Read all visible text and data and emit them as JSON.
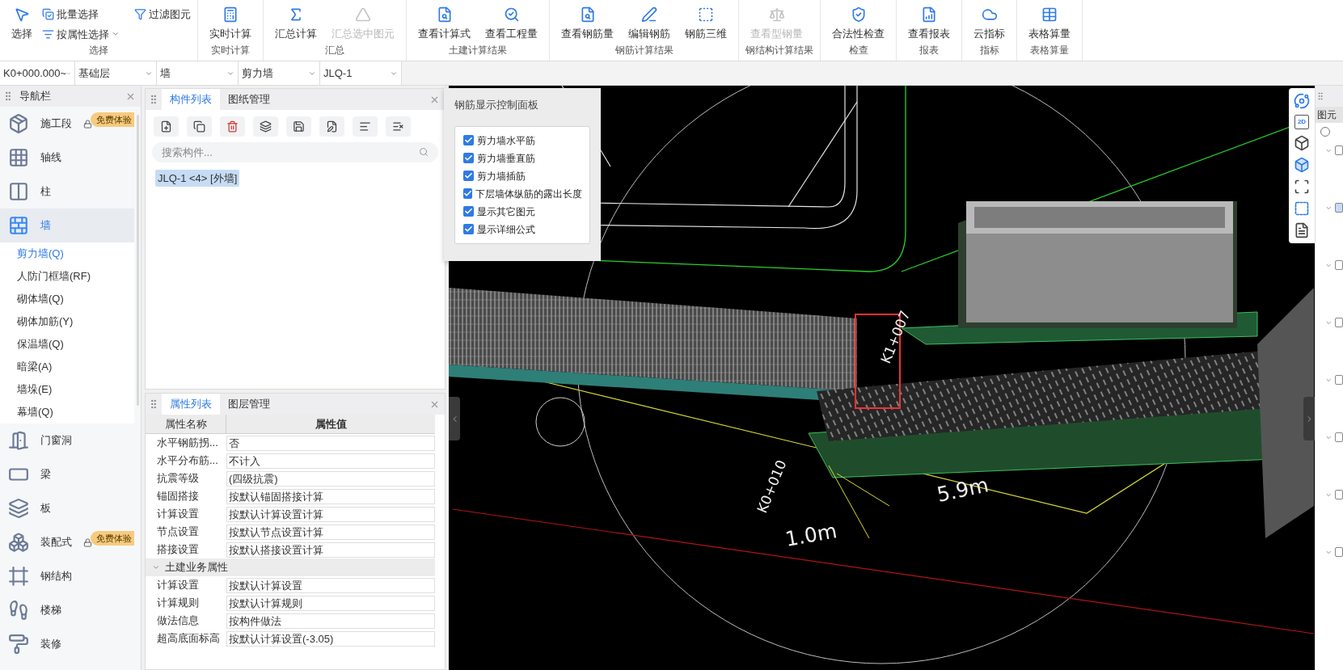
{
  "ribbon": {
    "groups": [
      {
        "label": "选择",
        "items": [
          {
            "label": "选择",
            "kind": "large",
            "disabled": false
          },
          {
            "label": "批量选择",
            "kind": "small",
            "disabled": false
          },
          {
            "label": "按属性选择",
            "kind": "small",
            "disabled": false,
            "has_menu": true
          },
          {
            "label": "过滤图元",
            "kind": "small",
            "disabled": false
          }
        ]
      },
      {
        "label": "实时计算",
        "items": [
          {
            "label": "实时计算",
            "kind": "large",
            "disabled": false
          }
        ]
      },
      {
        "label": "汇总",
        "items": [
          {
            "label": "汇总计算",
            "kind": "large",
            "disabled": false
          },
          {
            "label": "汇总选中图元",
            "kind": "large",
            "disabled": true
          }
        ]
      },
      {
        "label": "土建计算结果",
        "items": [
          {
            "label": "查看计算式",
            "kind": "large",
            "disabled": false
          },
          {
            "label": "查看工程量",
            "kind": "large",
            "disabled": false
          }
        ]
      },
      {
        "label": "钢筋计算结果",
        "items": [
          {
            "label": "查看钢筋量",
            "kind": "large",
            "disabled": false
          },
          {
            "label": "编辑钢筋",
            "kind": "large",
            "disabled": false
          },
          {
            "label": "钢筋三维",
            "kind": "large",
            "disabled": false
          }
        ]
      },
      {
        "label": "钢结构计算结果",
        "items": [
          {
            "label": "查看型钢量",
            "kind": "large",
            "disabled": true
          }
        ]
      },
      {
        "label": "检查",
        "items": [
          {
            "label": "合法性检查",
            "kind": "large",
            "disabled": false
          }
        ]
      },
      {
        "label": "报表",
        "items": [
          {
            "label": "查看报表",
            "kind": "large",
            "disabled": false
          }
        ]
      },
      {
        "label": "指标",
        "items": [
          {
            "label": "云指标",
            "kind": "large",
            "disabled": false
          }
        ]
      },
      {
        "label": "表格算量",
        "items": [
          {
            "label": "表格算量",
            "kind": "large",
            "disabled": false
          }
        ]
      }
    ]
  },
  "filters": [
    {
      "value": "K0+000.000~"
    },
    {
      "value": "基础层"
    },
    {
      "value": "墙"
    },
    {
      "value": "剪力墙"
    },
    {
      "value": "JLQ-1"
    }
  ],
  "navigation": {
    "title": "导航栏",
    "items": [
      {
        "label": "施工段",
        "selected": false,
        "locked": true,
        "badge": "免费体验"
      },
      {
        "label": "轴线",
        "selected": false
      },
      {
        "label": "柱",
        "selected": false
      },
      {
        "label": "墙",
        "selected": true,
        "children": [
          {
            "label": "剪力墙(Q)",
            "selected": true
          },
          {
            "label": "人防门框墙(RF)",
            "selected": false
          },
          {
            "label": "砌体墙(Q)",
            "selected": false
          },
          {
            "label": "砌体加筋(Y)",
            "selected": false
          },
          {
            "label": "保温墙(Q)",
            "selected": false
          },
          {
            "label": "暗梁(A)",
            "selected": false
          },
          {
            "label": "墙垛(E)",
            "selected": false
          },
          {
            "label": "幕墙(Q)",
            "selected": false
          }
        ]
      },
      {
        "label": "门窗洞",
        "selected": false
      },
      {
        "label": "梁",
        "selected": false
      },
      {
        "label": "板",
        "selected": false
      },
      {
        "label": "装配式",
        "selected": false,
        "locked": true,
        "badge": "免费体验"
      },
      {
        "label": "钢结构",
        "selected": false
      },
      {
        "label": "楼梯",
        "selected": false
      },
      {
        "label": "装修",
        "selected": false
      }
    ]
  },
  "component_panel": {
    "tabs": [
      {
        "label": "构件列表",
        "selected": true
      },
      {
        "label": "图纸管理",
        "selected": false
      }
    ],
    "search": {
      "placeholder": "搜索构件..."
    },
    "items": [
      {
        "label": "JLQ-1 <4> [外墙]",
        "selected": true
      }
    ]
  },
  "property_panel": {
    "tabs": [
      {
        "label": "属性列表",
        "selected": true
      },
      {
        "label": "图层管理",
        "selected": false
      }
    ],
    "columns": [
      "属性名称",
      "属性值"
    ],
    "rows": [
      {
        "kind": "row",
        "name": "水平钢筋拐...",
        "value": "否"
      },
      {
        "kind": "row",
        "name": "水平分布筋...",
        "value": "不计入"
      },
      {
        "kind": "row",
        "name": "抗震等级",
        "value": "(四级抗震)"
      },
      {
        "kind": "row",
        "name": "锚固搭接",
        "value": "按默认锚固搭接计算"
      },
      {
        "kind": "row",
        "name": "计算设置",
        "value": "按默认计算设置计算"
      },
      {
        "kind": "row",
        "name": "节点设置",
        "value": "按默认节点设置计算"
      },
      {
        "kind": "row",
        "name": "搭接设置",
        "value": "按默认搭接设置计算"
      },
      {
        "kind": "group",
        "name": "土建业务属性",
        "expanded": true
      },
      {
        "kind": "row",
        "name": "计算设置",
        "value": "按默认计算设置"
      },
      {
        "kind": "row",
        "name": "计算规则",
        "value": "按默认计算规则"
      },
      {
        "kind": "row",
        "name": "做法信息",
        "value": "按构件做法"
      },
      {
        "kind": "row",
        "name": "超高底面标高",
        "value": "按默认计算设置(-3.05)"
      }
    ]
  },
  "rebar_display_panel": {
    "title": "钢筋显示控制面板",
    "options": [
      {
        "label": "剪力墙水平筋",
        "checked": true
      },
      {
        "label": "剪力墙垂直筋",
        "checked": true
      },
      {
        "label": "剪力墙插筋",
        "checked": true
      },
      {
        "label": "下层墙体纵筋的露出长度",
        "checked": true
      },
      {
        "label": "显示其它图元",
        "checked": true
      },
      {
        "label": "显示详细公式",
        "checked": true
      }
    ]
  },
  "viewport": {
    "labels": [
      {
        "text": "5.9m"
      },
      {
        "text": "1.0m"
      },
      {
        "text": "K0+010"
      },
      {
        "text": "K1+007"
      }
    ],
    "view_toolbar": {
      "label_2d": "2D"
    }
  },
  "right_panel": {
    "tab": "图元",
    "radio_selected": false,
    "rows": [
      {
        "selected": false
      },
      {
        "selected": true
      },
      {
        "selected": false
      },
      {
        "selected": false
      },
      {
        "selected": false
      },
      {
        "selected": false
      },
      {
        "selected": false
      },
      {
        "selected": false
      }
    ]
  }
}
